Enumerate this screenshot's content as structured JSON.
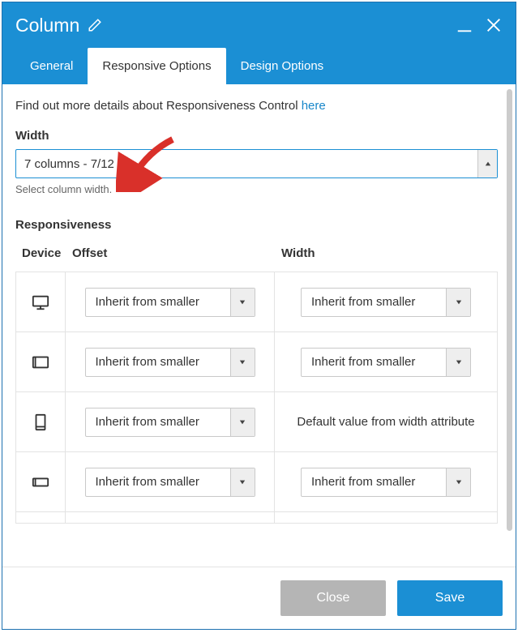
{
  "titlebar": {
    "title": "Column"
  },
  "tabs": {
    "general": "General",
    "responsive": "Responsive Options",
    "design": "Design Options"
  },
  "intro": {
    "text": "Find out more details about Responsiveness Control ",
    "link": "here"
  },
  "width": {
    "label": "Width",
    "value": "7 columns - 7/12",
    "hint": "Select column width."
  },
  "responsiveness": {
    "label": "Responsiveness",
    "headers": {
      "device": "Device",
      "offset": "Offset",
      "width": "Width"
    },
    "inherit": "Inherit from smaller",
    "default_msg": "Default value from width attribute",
    "rows": [
      {
        "device": "desktop",
        "offset": "inherit",
        "width": "inherit"
      },
      {
        "device": "tablet-landscape",
        "offset": "inherit",
        "width": "inherit"
      },
      {
        "device": "tablet-portrait",
        "offset": "inherit",
        "width": "default"
      },
      {
        "device": "phone-landscape",
        "offset": "inherit",
        "width": "inherit"
      }
    ]
  },
  "footer": {
    "close": "Close",
    "save": "Save"
  }
}
